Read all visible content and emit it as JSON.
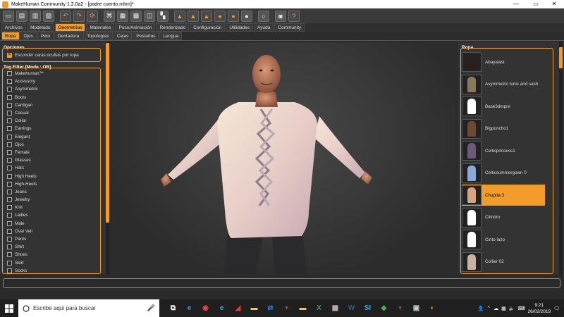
{
  "window": {
    "title": "MakeHuman Community 1.2.0a2 - [padre cuento.mhm]*",
    "minimize": "—",
    "maximize": "▭",
    "close": "✕"
  },
  "toolbar_icons": [
    "file-icon",
    "save-icon",
    "load-icon",
    "export-icon",
    "undo-icon",
    "redo-icon",
    "reset-icon",
    "wireframe-icon",
    "grid-icon",
    "background-icon",
    "smooth-icon",
    "checker-icon",
    "front-view-icon",
    "back-view-icon",
    "left-view-icon",
    "right-view-icon",
    "top-view-icon",
    "bottom-view-icon",
    "reset-camera-icon",
    "screenshot-icon",
    "help-icon"
  ],
  "main_tabs": [
    {
      "label": "Archivos",
      "active": false
    },
    {
      "label": "Modelado",
      "active": false
    },
    {
      "label": "Geometrías",
      "active": true
    },
    {
      "label": "Materiales",
      "active": false
    },
    {
      "label": "Pose/Animación",
      "active": false
    },
    {
      "label": "Renderizado",
      "active": false
    },
    {
      "label": "Configuración",
      "active": false
    },
    {
      "label": "Utilidades",
      "active": false
    },
    {
      "label": "Ayuda",
      "active": false
    },
    {
      "label": "Community",
      "active": false
    }
  ],
  "sub_tabs": [
    {
      "label": "Ropa",
      "active": true
    },
    {
      "label": "Ojos",
      "active": false
    },
    {
      "label": "Pelo",
      "active": false
    },
    {
      "label": "Dentadura",
      "active": false
    },
    {
      "label": "Topologías",
      "active": false
    },
    {
      "label": "Cejas",
      "active": false
    },
    {
      "label": "Pestañas",
      "active": false
    },
    {
      "label": "Lengua",
      "active": false
    }
  ],
  "options": {
    "title": "Opciones",
    "hide_faces_label": "Esconder caras ocultas por ropa",
    "hide_faces_checked": true
  },
  "tag_filter": {
    "title": "Tag Filter [Mode : OR]",
    "tags": [
      "Makehuman™",
      "Accessory",
      "Asymmetric",
      "Boots",
      "Cardigan",
      "Casual",
      "Collar",
      "Earrings",
      "Elegant",
      "Ojos",
      "Female",
      "Glasses",
      "Hats",
      "High Heels",
      "High-Heels",
      "Jeans",
      "Jewelry",
      "Knit",
      "Ladies",
      "Male",
      "Oval Veil",
      "Pants",
      "Shirt",
      "Shoes",
      "Skirt",
      "Socks"
    ]
  },
  "ropa": {
    "title": "Ropa",
    "items": [
      {
        "label": "Abayalast",
        "selected": false
      },
      {
        "label": "Asymmetric tunic and sash",
        "selected": false
      },
      {
        "label": "Base3dmpre",
        "selected": false
      },
      {
        "label": "Bigponcho1",
        "selected": false
      },
      {
        "label": "Celticprincess1",
        "selected": false
      },
      {
        "label": "Celticsummergown 0",
        "selected": false
      },
      {
        "label": "Chupita 3",
        "selected": true
      },
      {
        "label": "Cilindro",
        "selected": false
      },
      {
        "label": "Cinto lazo",
        "selected": false
      },
      {
        "label": "Collier 02",
        "selected": false
      }
    ]
  },
  "taskbar": {
    "search_placeholder": "Escribe aquí para buscar",
    "time": "9:21",
    "date": "26/02/2019",
    "apps": [
      "task-view-icon",
      "edge-icon",
      "chrome-icon",
      "ie-icon",
      "acrobat-icon",
      "folder-icon",
      "teamviewer-icon",
      "makehuman-icon",
      "folder-icon",
      "excel-icon",
      "calculator-icon",
      "word-icon",
      "si-icon",
      "app-icon",
      "makehuman-icon",
      "explorer-icon",
      "blender-icon"
    ]
  },
  "colors": {
    "accent": "#f39c2b",
    "panel": "#333333",
    "viewport": "#3a3a3a"
  }
}
